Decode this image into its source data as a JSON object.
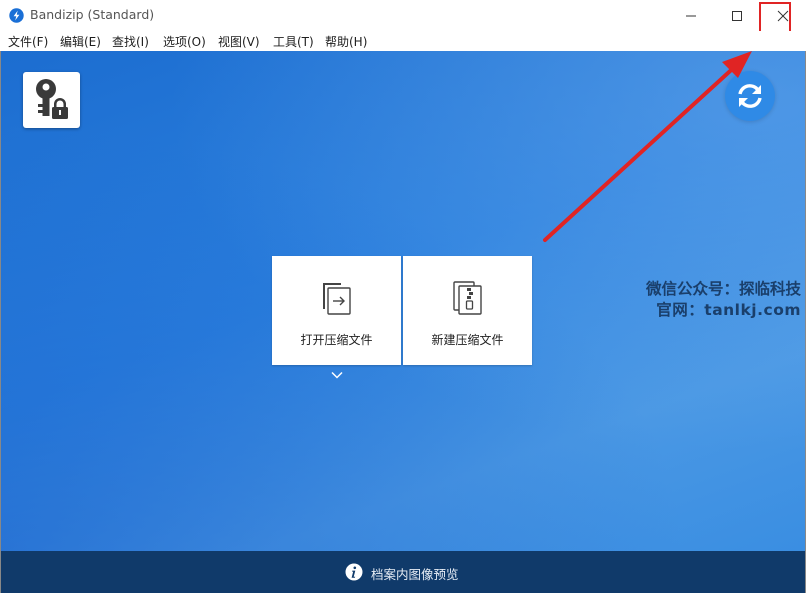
{
  "window": {
    "title": "Bandizip (Standard)",
    "icon": "bandizip-logo-icon",
    "controls": {
      "minimize": "minimize-icon",
      "maximize": "maximize-icon",
      "close": "close-icon"
    }
  },
  "menubar": {
    "items": [
      "文件(F)",
      "编辑(E)",
      "查找(I)",
      "选项(O)",
      "视图(V)",
      "工具(T)",
      "帮助(H)"
    ]
  },
  "main": {
    "password_button_icon": "key-lock-icon",
    "update_button_icon": "refresh-icon",
    "tiles": [
      {
        "label": "打开压缩文件",
        "icon": "open-archive-icon"
      },
      {
        "label": "新建压缩文件",
        "icon": "new-archive-icon"
      }
    ],
    "watermark": {
      "line1": "微信公众号：探临科技",
      "line2": "官网：tanlkj.com"
    }
  },
  "bottombar": {
    "label": "档案内图像预览",
    "icon": "info-icon"
  },
  "colors": {
    "main_background": "#2b80de",
    "bottom_bar": "#103a6a",
    "annotation": "#e02424",
    "update_button": "#2f8ae6"
  }
}
